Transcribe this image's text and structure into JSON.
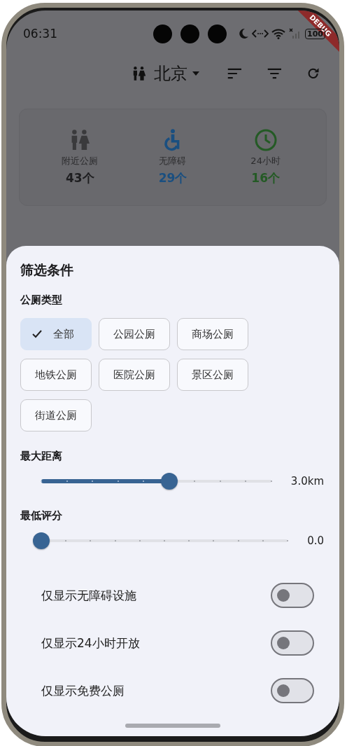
{
  "status_bar": {
    "time": "06:31",
    "battery": "100"
  },
  "debug_banner": "DEBUG",
  "app_bar": {
    "city": "北京"
  },
  "stats": [
    {
      "label": "附近公厕",
      "value": "43个",
      "color": "#1e1e20",
      "kind": "people"
    },
    {
      "label": "无障碍",
      "value": "29个",
      "color": "#1a4f80",
      "kind": "wheelchair"
    },
    {
      "label": "24小时",
      "value": "16个",
      "color": "#245a25",
      "kind": "clock"
    }
  ],
  "sheet": {
    "title": "筛选条件",
    "type_section": {
      "label": "公厕类型",
      "chips": [
        {
          "label": "全部",
          "selected": true
        },
        {
          "label": "公园公厕",
          "selected": false
        },
        {
          "label": "商场公厕",
          "selected": false
        },
        {
          "label": "地铁公厕",
          "selected": false
        },
        {
          "label": "医院公厕",
          "selected": false
        },
        {
          "label": "景区公厕",
          "selected": false
        },
        {
          "label": "街道公厕",
          "selected": false
        }
      ]
    },
    "distance": {
      "label": "最大距离",
      "level": 0.556,
      "reading": "3.0km"
    },
    "rating": {
      "label": "最低评分",
      "level": 0,
      "reading": "0.0"
    },
    "toggles": [
      {
        "label": "仅显示无障碍设施",
        "on": false
      },
      {
        "label": "仅显示24小时开放",
        "on": false
      },
      {
        "label": "仅显示免费公厕",
        "on": false
      }
    ]
  }
}
